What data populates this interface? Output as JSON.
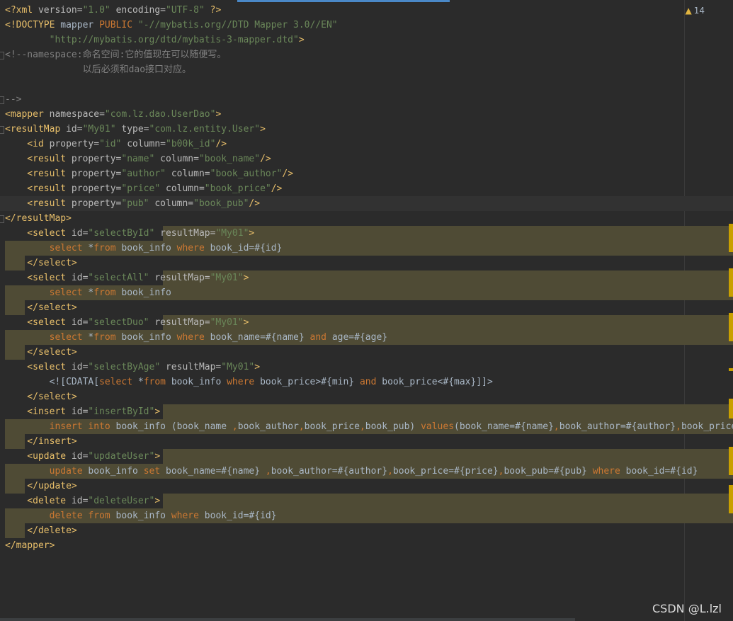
{
  "editor": {
    "inspection_count": "14",
    "lines": [
      {
        "segs": [
          [
            "tag",
            "<?xml "
          ],
          [
            "attr",
            "version="
          ],
          [
            "val",
            "\"1.0\" "
          ],
          [
            "attr",
            "encoding="
          ],
          [
            "val",
            "\"UTF-8\" "
          ],
          [
            "tag",
            "?>"
          ]
        ]
      },
      {
        "segs": [
          [
            "tag",
            "<!DOCTYPE "
          ],
          [
            "plain",
            "mapper "
          ],
          [
            "kw",
            "PUBLIC "
          ],
          [
            "val",
            "\"-//mybatis.org//DTD Mapper 3.0//EN\""
          ]
        ]
      },
      {
        "segs": [
          [
            "val",
            "        \"http://mybatis.org/dtd/mybatis-3-mapper.dtd\""
          ],
          [
            "tag",
            ">"
          ]
        ]
      },
      {
        "segs": [
          [
            "cmt",
            "<!--namespace:命名空间:它的值现在可以随便写。"
          ]
        ]
      },
      {
        "segs": [
          [
            "cmt",
            "              以后必须和dao接口对应。"
          ]
        ]
      },
      {
        "segs": [
          [
            "cmt",
            ""
          ]
        ]
      },
      {
        "segs": [
          [
            "cmt",
            "-->"
          ]
        ]
      },
      {
        "segs": [
          [
            "tag",
            "<mapper "
          ],
          [
            "attr",
            "namespace="
          ],
          [
            "val",
            "\"com.lz.dao.UserDao\""
          ],
          [
            "tag",
            ">"
          ]
        ]
      },
      {
        "segs": [
          [
            "tag",
            "<resultMap "
          ],
          [
            "attr",
            "id="
          ],
          [
            "val",
            "\"My01\" "
          ],
          [
            "attr",
            "type="
          ],
          [
            "val",
            "\"com.lz.entity.User\""
          ],
          [
            "tag",
            ">"
          ]
        ]
      },
      {
        "segs": [
          [
            "tag",
            "    <id "
          ],
          [
            "attr",
            "property="
          ],
          [
            "val",
            "\"id\" "
          ],
          [
            "attr",
            "column="
          ],
          [
            "val",
            "\"b00k_id\""
          ],
          [
            "tag",
            "/>"
          ]
        ]
      },
      {
        "segs": [
          [
            "tag",
            "    <result "
          ],
          [
            "attr",
            "property="
          ],
          [
            "val",
            "\"name\" "
          ],
          [
            "attr",
            "column="
          ],
          [
            "val",
            "\"book_name\""
          ],
          [
            "tag",
            "/>"
          ]
        ]
      },
      {
        "segs": [
          [
            "tag",
            "    <result "
          ],
          [
            "attr",
            "property="
          ],
          [
            "val",
            "\"author\" "
          ],
          [
            "attr",
            "column="
          ],
          [
            "val",
            "\"book_author\""
          ],
          [
            "tag",
            "/>"
          ]
        ]
      },
      {
        "segs": [
          [
            "tag",
            "    <result "
          ],
          [
            "attr",
            "property="
          ],
          [
            "val",
            "\"price\" "
          ],
          [
            "attr",
            "column="
          ],
          [
            "val",
            "\"book_price\""
          ],
          [
            "tag",
            "/>"
          ]
        ]
      },
      {
        "segs": [
          [
            "tag",
            "    <result "
          ],
          [
            "attr",
            "property="
          ],
          [
            "val",
            "\"pub\" "
          ],
          [
            "attr",
            "column="
          ],
          [
            "val",
            "\"book_pub\""
          ],
          [
            "tag",
            "/>"
          ]
        ]
      },
      {
        "segs": [
          [
            "tag",
            "</resultMap>"
          ]
        ]
      },
      {
        "segs": [
          [
            "tag",
            "    <select "
          ],
          [
            "attr",
            "id="
          ],
          [
            "val",
            "\"selectById\" "
          ],
          [
            "attr",
            "resultMap="
          ],
          [
            "val",
            "\"My01\""
          ],
          [
            "tag",
            ">"
          ]
        ]
      },
      {
        "segs": [
          [
            "kw",
            "        select "
          ],
          [
            "plain",
            "*"
          ],
          [
            "kw",
            "from "
          ],
          [
            "plain",
            "book_info "
          ],
          [
            "kw",
            "where "
          ],
          [
            "plain",
            "book_id=#{id}"
          ]
        ]
      },
      {
        "segs": [
          [
            "tag",
            "    </select>"
          ]
        ]
      },
      {
        "segs": [
          [
            "tag",
            "    <select "
          ],
          [
            "attr",
            "id="
          ],
          [
            "val",
            "\"selectAll\" "
          ],
          [
            "attr",
            "resultMap="
          ],
          [
            "val",
            "\"My01\""
          ],
          [
            "tag",
            ">"
          ]
        ]
      },
      {
        "segs": [
          [
            "kw",
            "        select "
          ],
          [
            "plain",
            "*"
          ],
          [
            "kw",
            "from "
          ],
          [
            "plain",
            "book_info"
          ]
        ]
      },
      {
        "segs": [
          [
            "tag",
            "    </select>"
          ]
        ]
      },
      {
        "segs": [
          [
            "tag",
            "    <select "
          ],
          [
            "attr",
            "id="
          ],
          [
            "val",
            "\"selectDuo\" "
          ],
          [
            "attr",
            "resultMap="
          ],
          [
            "val",
            "\"My01\""
          ],
          [
            "tag",
            ">"
          ]
        ]
      },
      {
        "segs": [
          [
            "kw",
            "        select "
          ],
          [
            "plain",
            "*"
          ],
          [
            "kw",
            "from "
          ],
          [
            "plain",
            "book_info "
          ],
          [
            "kw",
            "where "
          ],
          [
            "plain",
            "book_name=#{name} "
          ],
          [
            "kw",
            "and "
          ],
          [
            "plain",
            "age=#{age}"
          ]
        ]
      },
      {
        "segs": [
          [
            "tag",
            "    </select>"
          ]
        ]
      },
      {
        "segs": [
          [
            "tag",
            "    <select "
          ],
          [
            "attr",
            "id="
          ],
          [
            "val",
            "\"selectByAge\" "
          ],
          [
            "attr",
            "resultMap="
          ],
          [
            "val",
            "\"My01\""
          ],
          [
            "tag",
            ">"
          ]
        ]
      },
      {
        "segs": [
          [
            "plain",
            "        <![CDATA["
          ],
          [
            "kw",
            "select "
          ],
          [
            "plain",
            "*"
          ],
          [
            "kw",
            "from "
          ],
          [
            "plain",
            "book_info "
          ],
          [
            "kw",
            "where "
          ],
          [
            "plain",
            "book_price>#{min} "
          ],
          [
            "kw",
            "and "
          ],
          [
            "plain",
            "book_price<#{max}"
          ],
          [
            "plain",
            "]]>"
          ]
        ]
      },
      {
        "segs": [
          [
            "tag",
            "    </select>"
          ]
        ]
      },
      {
        "segs": [
          [
            "tag",
            "    <insert "
          ],
          [
            "attr",
            "id="
          ],
          [
            "val",
            "\"insertById\""
          ],
          [
            "tag",
            ">"
          ]
        ]
      },
      {
        "segs": [
          [
            "kw",
            "        insert "
          ],
          [
            "kw",
            "into "
          ],
          [
            "plain",
            "book_info (book_name "
          ],
          [
            "kw",
            ","
          ],
          [
            "plain",
            "book_author"
          ],
          [
            "kw",
            ","
          ],
          [
            "plain",
            "book_price"
          ],
          [
            "kw",
            ","
          ],
          [
            "plain",
            "book_pub) "
          ],
          [
            "kw",
            "values"
          ],
          [
            "plain",
            "(book_name=#{name}"
          ],
          [
            "kw",
            ","
          ],
          [
            "plain",
            "book_author=#{author}"
          ],
          [
            "kw",
            ","
          ],
          [
            "plain",
            "book_price=#{price}"
          ]
        ]
      },
      {
        "segs": [
          [
            "tag",
            "    </insert>"
          ]
        ]
      },
      {
        "segs": [
          [
            "tag",
            "    <update "
          ],
          [
            "attr",
            "id="
          ],
          [
            "val",
            "\"updateUser\""
          ],
          [
            "tag",
            ">"
          ]
        ]
      },
      {
        "segs": [
          [
            "kw",
            "        update "
          ],
          [
            "plain",
            "book_info "
          ],
          [
            "kw",
            "set "
          ],
          [
            "plain",
            "book_name=#{name} "
          ],
          [
            "kw",
            ","
          ],
          [
            "plain",
            "book_author=#{author}"
          ],
          [
            "kw",
            ","
          ],
          [
            "plain",
            "book_price=#{price}"
          ],
          [
            "kw",
            ","
          ],
          [
            "plain",
            "book_pub=#{pub} "
          ],
          [
            "kw",
            "where "
          ],
          [
            "plain",
            "book_id=#{id}"
          ]
        ]
      },
      {
        "segs": [
          [
            "tag",
            "    </update>"
          ]
        ]
      },
      {
        "segs": [
          [
            "tag",
            "    <delete "
          ],
          [
            "attr",
            "id="
          ],
          [
            "val",
            "\"deleteUser\""
          ],
          [
            "tag",
            ">"
          ]
        ]
      },
      {
        "segs": [
          [
            "kw",
            "        delete "
          ],
          [
            "kw",
            "from "
          ],
          [
            "plain",
            "book_info "
          ],
          [
            "kw",
            "where "
          ],
          [
            "plain",
            "book_id=#{id}"
          ]
        ]
      },
      {
        "segs": [
          [
            "tag",
            "    </delete>"
          ]
        ]
      },
      {
        "segs": [
          [
            "tag",
            "</mapper>"
          ]
        ]
      }
    ]
  },
  "watermark": "CSDN @L.lzl",
  "colors": {
    "background": "#2b2b2b",
    "tag": "#e8bf6a",
    "attr": "#bababa",
    "value": "#6a8759",
    "keyword": "#cc7832",
    "comment": "#808080"
  }
}
